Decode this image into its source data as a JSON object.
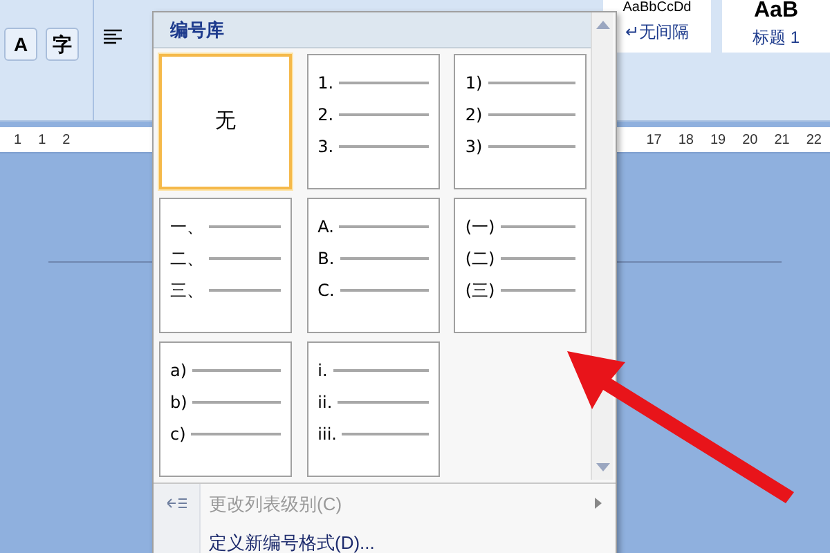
{
  "ribbon": {
    "left_buttons": [
      "A",
      "字"
    ],
    "styles": [
      {
        "preview": "AaBbCcDd",
        "name": "↵无间隔"
      },
      {
        "preview": "AaB",
        "name": "标题 1"
      }
    ]
  },
  "ruler": {
    "left_numbers": [
      "1",
      "1",
      "2"
    ],
    "right_numbers": [
      "17",
      "18",
      "19",
      "20",
      "21",
      "22"
    ]
  },
  "numbering_menu": {
    "title": "编号库",
    "tiles": [
      {
        "kind": "none",
        "label": "无",
        "selected": true
      },
      {
        "kind": "list",
        "selected": false,
        "markers": [
          "1.",
          "2.",
          "3."
        ]
      },
      {
        "kind": "list",
        "selected": false,
        "markers": [
          "1)",
          "2)",
          "3)"
        ]
      },
      {
        "kind": "list",
        "selected": false,
        "markers": [
          "一、",
          "二、",
          "三、"
        ]
      },
      {
        "kind": "list",
        "selected": false,
        "markers": [
          "A.",
          "B.",
          "C."
        ]
      },
      {
        "kind": "list",
        "selected": false,
        "markers": [
          "(一)",
          "(二)",
          "(三)"
        ]
      },
      {
        "kind": "list",
        "selected": false,
        "markers": [
          "a)",
          "b)",
          "c)"
        ]
      },
      {
        "kind": "list",
        "selected": false,
        "markers": [
          "i.",
          "ii.",
          "iii."
        ]
      }
    ],
    "items": [
      {
        "label": "更改列表级别(C)",
        "disabled": true,
        "submenu": true
      },
      {
        "label": "定义新编号格式(D)...",
        "disabled": false,
        "submenu": false
      }
    ]
  }
}
